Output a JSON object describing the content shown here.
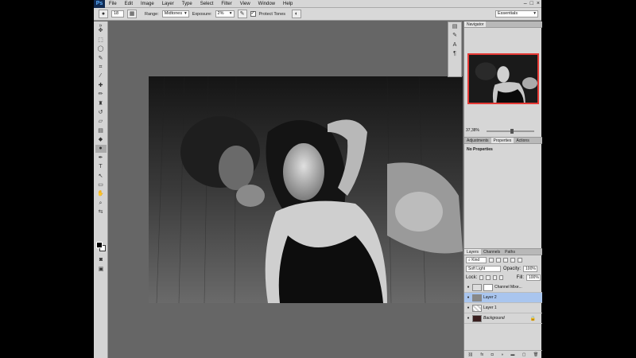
{
  "app": {
    "logo": "Ps"
  },
  "menu": [
    "File",
    "Edit",
    "Image",
    "Layer",
    "Type",
    "Select",
    "Filter",
    "View",
    "Window",
    "Help"
  ],
  "window_controls": [
    "–",
    "□",
    "×"
  ],
  "options": {
    "brush_size": "18",
    "range_label": "Range:",
    "range_value": "Midtones",
    "exposure_label": "Exposure:",
    "exposure_value": "2%",
    "protect_tones_label": "Protect Tones",
    "workspace": "Essentials"
  },
  "navigator": {
    "tab": "Navigator",
    "zoom": "37,38%"
  },
  "properties": {
    "tabs": [
      "Adjustments",
      "Properties",
      "Actions"
    ],
    "title": "No Properties"
  },
  "layers": {
    "tabs": [
      "Layers",
      "Channels",
      "Paths"
    ],
    "kind": "Kind",
    "blend_mode": "Soft Light",
    "opacity_label": "Opacity:",
    "opacity_value": "100%",
    "lock_label": "Lock:",
    "fill_label": "Fill:",
    "fill_value": "100%",
    "items": [
      {
        "name": "Channel Mixe...",
        "italic": false
      },
      {
        "name": "Layer 2",
        "italic": false
      },
      {
        "name": "Layer 1",
        "italic": false
      },
      {
        "name": "Background",
        "italic": true
      }
    ],
    "footer_icons": [
      "link-icon",
      "fx-icon",
      "mask-icon",
      "adjustment-icon",
      "folder-icon",
      "new-layer-icon",
      "trash-icon"
    ]
  },
  "colors": {
    "selected_layer": "#a9c5ee",
    "navigator_frame": "#e53935"
  }
}
